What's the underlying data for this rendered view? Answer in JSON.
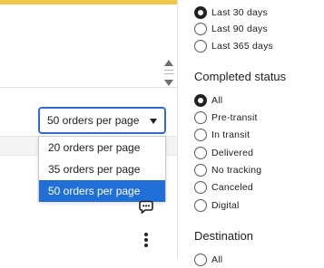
{
  "pagination": {
    "selected": "50 orders per page",
    "options": [
      "20 orders per page",
      "35 orders per page",
      "50 orders per page"
    ]
  },
  "icons": {
    "chat": "chat-icon",
    "more": "more-vertical-icon",
    "scroll_up": "chevron-up-icon",
    "scroll_down": "chevron-down-icon"
  },
  "filters": {
    "date_options": [
      "Last 30 days",
      "Last 90 days",
      "Last 365 days"
    ],
    "date_selected": "Last 30 days",
    "completed_status": {
      "heading": "Completed status",
      "options": [
        "All",
        "Pre-transit",
        "In transit",
        "Delivered",
        "No tracking",
        "Canceled",
        "Digital"
      ],
      "selected": "All"
    },
    "destination": {
      "heading": "Destination",
      "options": [
        "All"
      ]
    }
  },
  "colors": {
    "accent_blue": "#2f69d3",
    "highlight_blue": "#1f6fd6",
    "top_accent": "#f3c74a"
  }
}
